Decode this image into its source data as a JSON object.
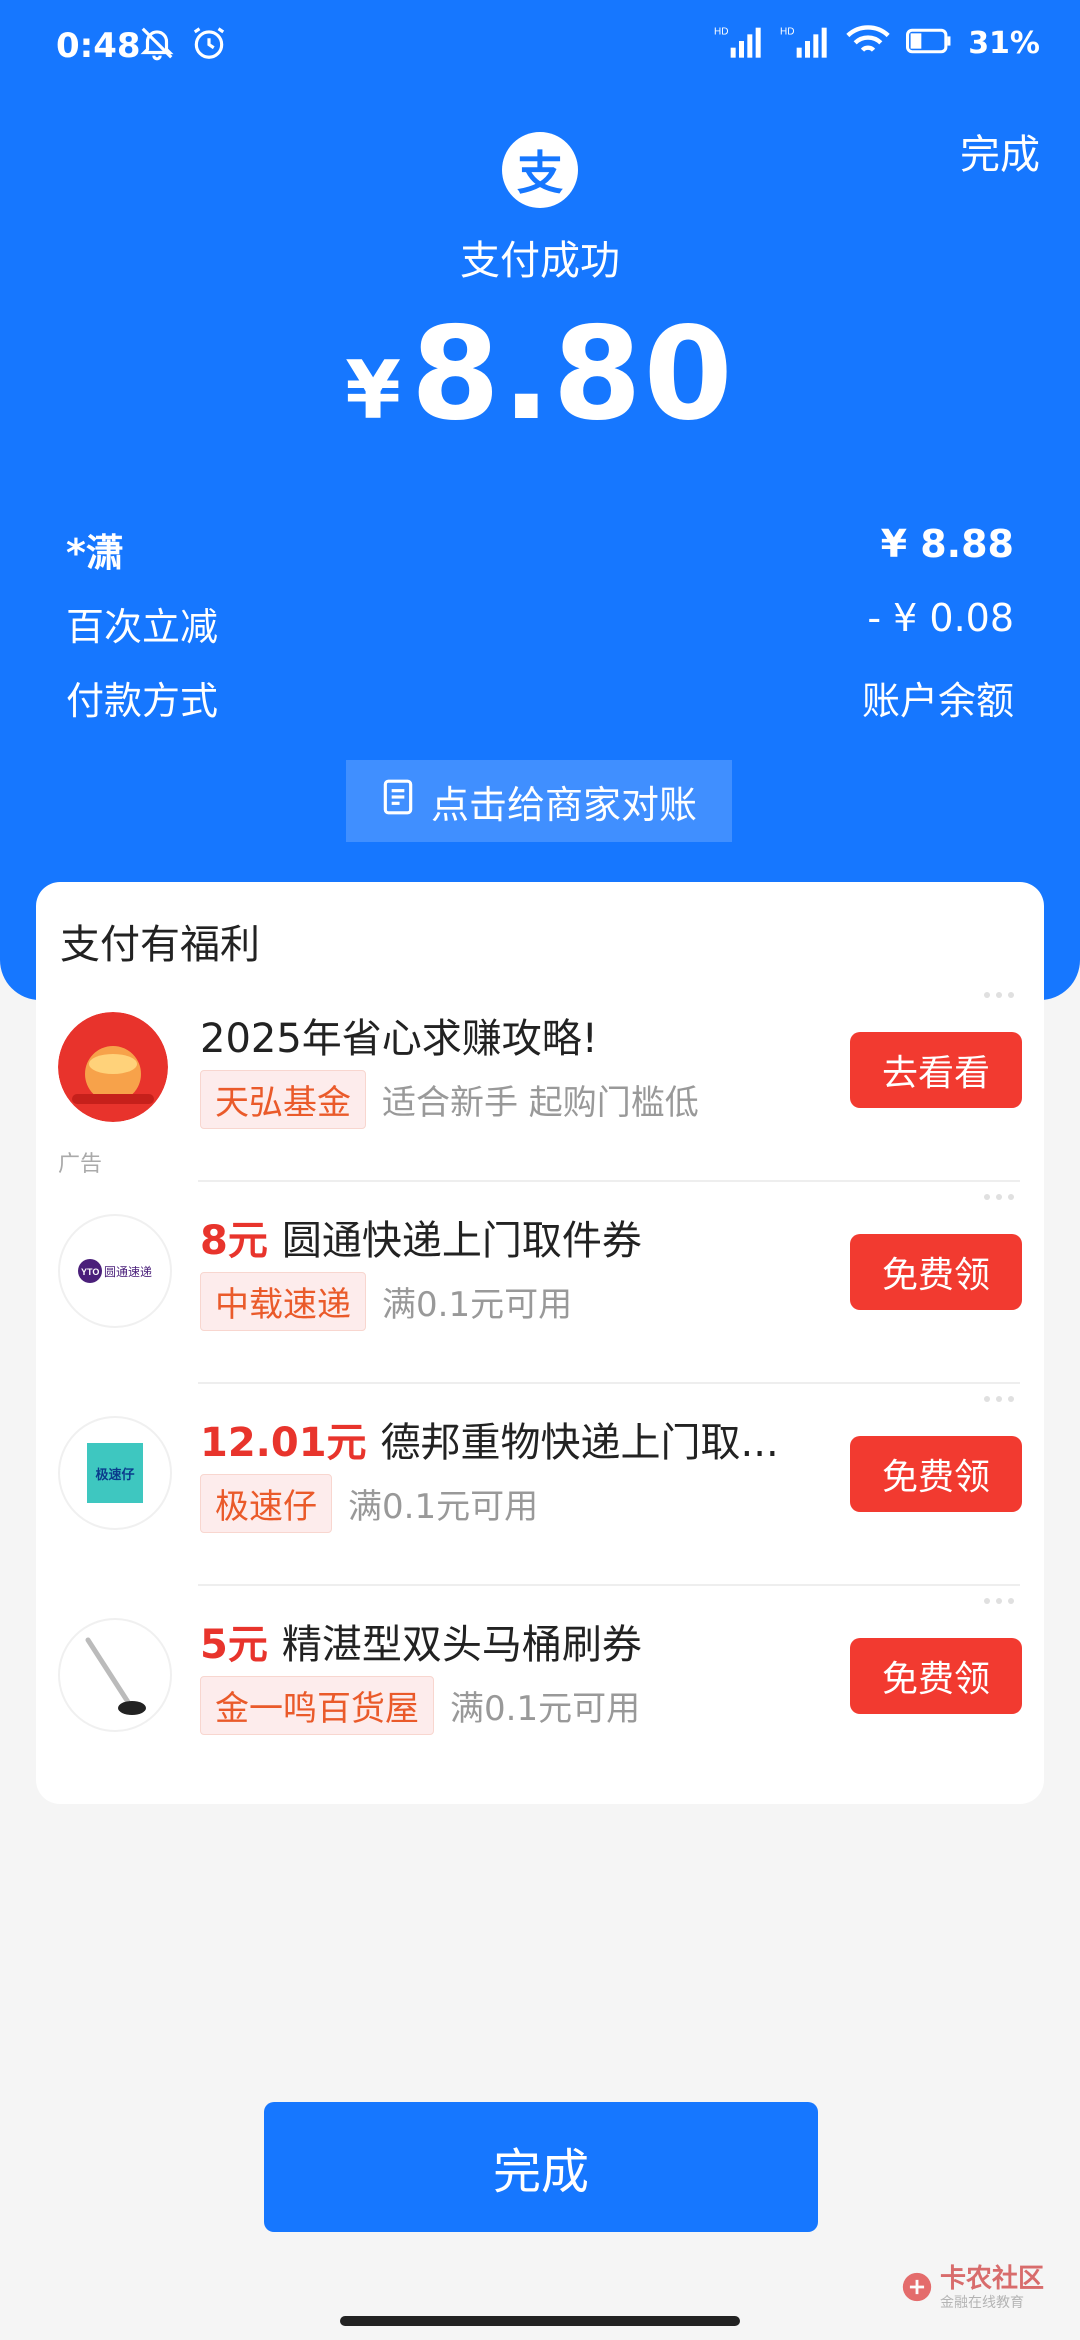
{
  "status_bar": {
    "time": "0:48",
    "battery": "31%"
  },
  "header": {
    "done_top": "完成",
    "logo_char": "支",
    "status": "支付成功",
    "currency": "¥",
    "amount": "8.80"
  },
  "details": [
    {
      "label": "*潇",
      "value": "¥ 8.88"
    },
    {
      "label": "百次立减",
      "value": "- ¥ 0.08"
    },
    {
      "label": "付款方式",
      "value": "账户余额"
    }
  ],
  "reconcile_button": "点击给商家对账",
  "benefits": {
    "title": "支付有福利",
    "ad_label": "广告",
    "items": [
      {
        "price": "",
        "title": "2025年省心求赚攻略!",
        "tag": "天弘基金",
        "sub": "适合新手 起购门槛低",
        "button": "去看看",
        "icon": "fund-promo-icon"
      },
      {
        "price": "8元",
        "title": "圆通快递上门取件券",
        "tag": "中载速递",
        "sub": "满0.1元可用",
        "button": "免费领",
        "icon": "yto-express-logo",
        "logo_text": "圆通速递"
      },
      {
        "price": "12.01元",
        "title": "德邦重物快递上门取...",
        "tag": "极速仔",
        "sub": "满0.1元可用",
        "button": "免费领",
        "icon": "jisuzai-logo",
        "logo_text": "极速仔"
      },
      {
        "price": "5元",
        "title": "精湛型双头马桶刷券",
        "tag": "金一鸣百货屋",
        "sub": "满0.1元可用",
        "button": "免费领",
        "icon": "toilet-brush-icon"
      }
    ]
  },
  "done_bottom": "完成",
  "watermark": {
    "text": "卡农社区",
    "sub": "金融在线教育"
  },
  "colors": {
    "primary": "#1677ff",
    "action": "#f23a30",
    "price": "#e8342c"
  }
}
